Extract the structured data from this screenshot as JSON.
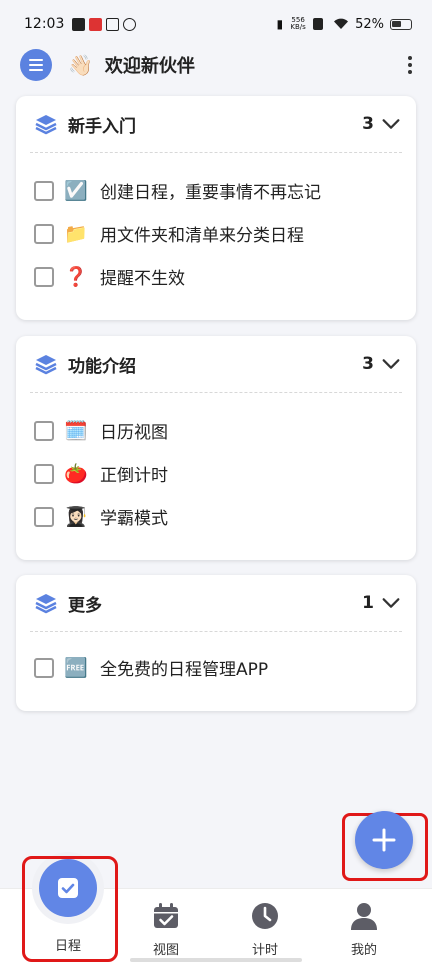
{
  "status_bar": {
    "time": "12:03",
    "net_speed": "556",
    "net_unit": "KB/s",
    "battery": "52%"
  },
  "header": {
    "wave_emoji": "👋🏻",
    "title": "欢迎新伙伴"
  },
  "sections": [
    {
      "title": "新手入门",
      "count": "3",
      "items": [
        {
          "emoji": "☑️",
          "label": "创建日程，重要事情不再忘记"
        },
        {
          "emoji": "📁",
          "label": "用文件夹和清单来分类日程"
        },
        {
          "emoji": "❓",
          "label": "提醒不生效"
        }
      ]
    },
    {
      "title": "功能介绍",
      "count": "3",
      "items": [
        {
          "emoji": "🗓️",
          "label": "日历视图"
        },
        {
          "emoji": "🍅",
          "label": "正倒计时"
        },
        {
          "emoji": "👩🏻‍🎓",
          "label": "学霸模式"
        }
      ]
    },
    {
      "title": "更多",
      "count": "1",
      "items": [
        {
          "emoji": "🆓",
          "label": "全免费的日程管理APP"
        }
      ]
    }
  ],
  "fab": {
    "label": "+"
  },
  "bottom_nav": {
    "schedule": "日程",
    "view": "视图",
    "timer": "计时",
    "mine": "我的"
  },
  "colors": {
    "accent": "#6186e6",
    "highlight_ring": "#e01818",
    "background": "#f4f5f9"
  }
}
